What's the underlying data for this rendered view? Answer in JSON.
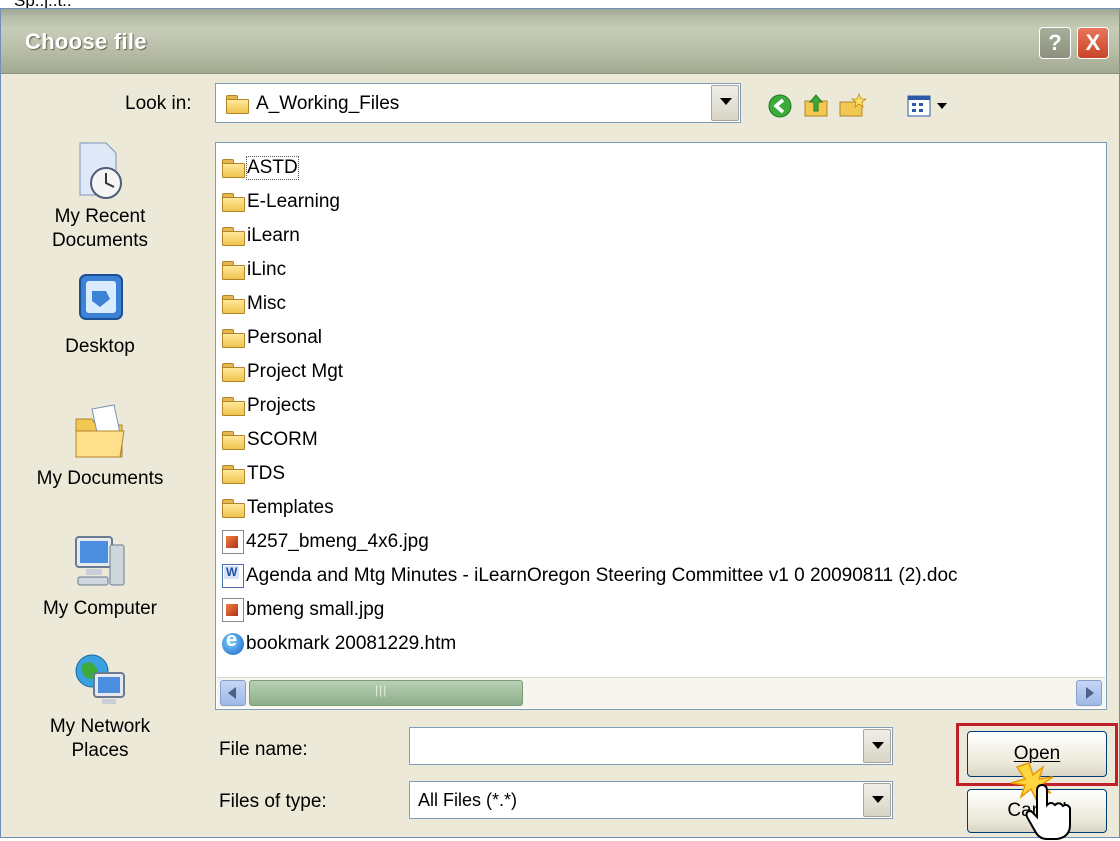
{
  "top_fragment": "Sp..j..t..",
  "title": "Choose file",
  "title_buttons": {
    "help": "?",
    "close": "X"
  },
  "look_in": {
    "label": "Look in:",
    "value": "A_Working_Files"
  },
  "toolbar": [
    "back-icon",
    "up-folder-icon",
    "new-folder-icon",
    "view-menu-icon"
  ],
  "places": [
    {
      "label_line1": "My Recent",
      "label_line2": "Documents",
      "icon": "recent-documents-icon"
    },
    {
      "label_line1": "Desktop",
      "label_line2": "",
      "icon": "desktop-icon"
    },
    {
      "label_line1": "My Documents",
      "label_line2": "",
      "icon": "my-documents-icon"
    },
    {
      "label_line1": "My Computer",
      "label_line2": "",
      "icon": "my-computer-icon"
    },
    {
      "label_line1": "My Network",
      "label_line2": "Places",
      "icon": "network-places-icon"
    }
  ],
  "files": [
    {
      "name": "ASTD",
      "type": "folder"
    },
    {
      "name": "E-Learning",
      "type": "folder"
    },
    {
      "name": "iLearn",
      "type": "folder"
    },
    {
      "name": "iLinc",
      "type": "folder"
    },
    {
      "name": "Misc",
      "type": "folder"
    },
    {
      "name": "Personal",
      "type": "folder"
    },
    {
      "name": "Project Mgt",
      "type": "folder"
    },
    {
      "name": "Projects",
      "type": "folder"
    },
    {
      "name": "SCORM",
      "type": "folder"
    },
    {
      "name": "TDS",
      "type": "folder"
    },
    {
      "name": "Templates",
      "type": "folder"
    },
    {
      "name": "4257_bmeng_4x6.jpg",
      "type": "image"
    },
    {
      "name": "Agenda and Mtg Minutes - iLearnOregon Steering Committee v1 0 20090811 (2).doc",
      "type": "doc"
    },
    {
      "name": "bmeng small.jpg",
      "type": "image"
    },
    {
      "name": "bookmark 20081229.htm",
      "type": "web"
    }
  ],
  "side_column_icons": [
    "pdf-file-icon",
    "excel-file-icon",
    "ie-file-icon",
    "captivate-file-icon",
    "excel-file-icon",
    "image-file-icon",
    "captivate-file-icon",
    "word-file-icon",
    "excel-file-icon",
    "excel-file-icon",
    "presentation-file-icon",
    "presentation-file-icon",
    "word-file-icon",
    "email-file-icon",
    "picture-file-icon"
  ],
  "file_name": {
    "label": "File name:",
    "value": ""
  },
  "file_type": {
    "label": "Files of type:",
    "value": "All Files (*.*)"
  },
  "buttons": {
    "open": "Open",
    "cancel": "Cancel"
  },
  "colors": {
    "highlight": "#c0202a",
    "dialog_bg": "#ece9d8"
  }
}
